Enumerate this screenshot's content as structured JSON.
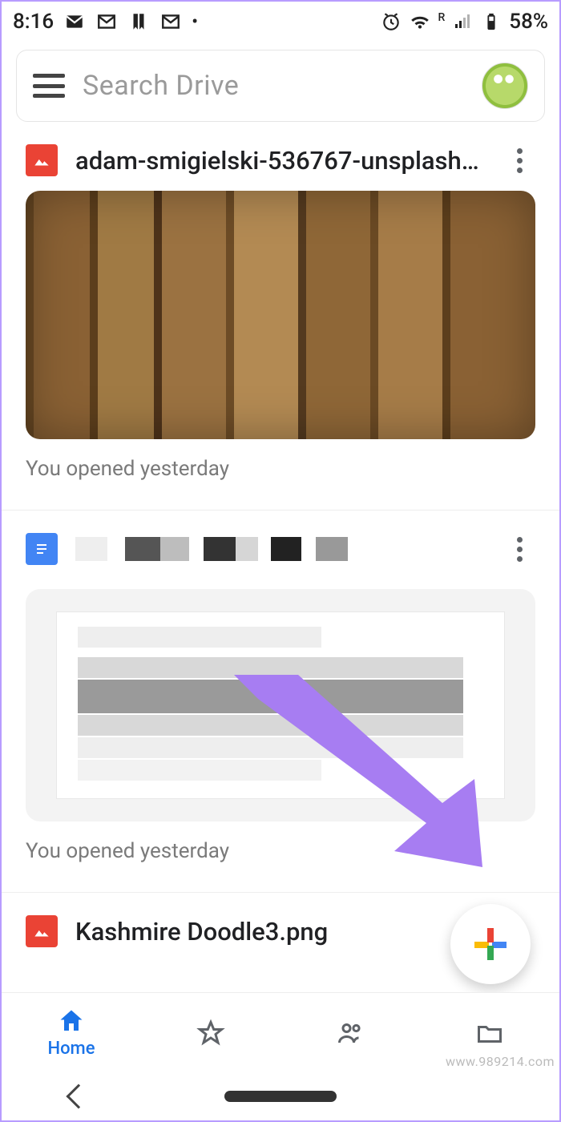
{
  "status": {
    "time": "8:16",
    "battery": "58%",
    "signal_prefix": "R"
  },
  "search": {
    "placeholder": "Search Drive"
  },
  "files": [
    {
      "type": "image",
      "name": "adam-smigielski-536767-unsplash.jpg",
      "subtitle": "You opened yesterday"
    },
    {
      "type": "doc",
      "name": "",
      "subtitle": "You opened yesterday"
    },
    {
      "type": "image",
      "name": "Kashmire Doodle3.png",
      "subtitle": ""
    }
  ],
  "nav": {
    "home": "Home"
  },
  "watermark": "www.989214.com"
}
